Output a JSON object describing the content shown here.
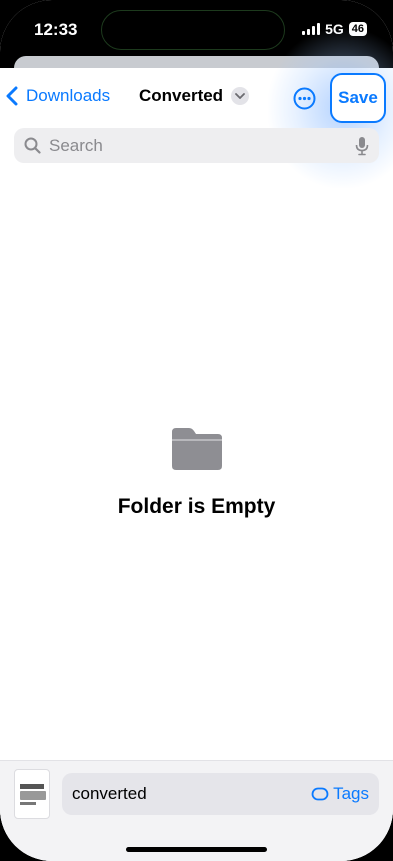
{
  "status_bar": {
    "time": "12:33",
    "network": "5G",
    "battery": "46"
  },
  "nav": {
    "back_label": "Downloads",
    "title": "Converted",
    "save_label": "Save",
    "more_icon": "ellipsis-circle-icon",
    "accent_color": "#0a7aff"
  },
  "search": {
    "placeholder": "Search"
  },
  "empty_state": {
    "icon": "folder-icon",
    "message": "Folder is Empty"
  },
  "footer": {
    "filename": "converted",
    "tags_label": "Tags"
  }
}
